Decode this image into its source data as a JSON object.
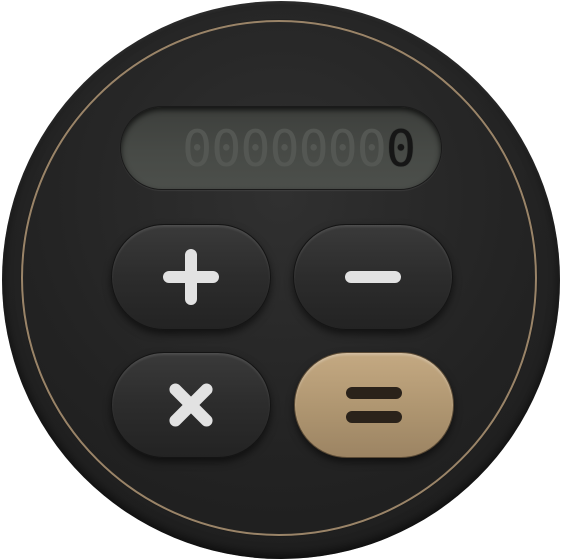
{
  "display": {
    "ghost_digits": "0000000",
    "value": "0"
  },
  "keys": {
    "add": {
      "icon": "plus-icon"
    },
    "subtract": {
      "icon": "minus-icon"
    },
    "multiply": {
      "icon": "times-icon"
    },
    "equals": {
      "icon": "equals-icon"
    }
  },
  "colors": {
    "body": "#232323",
    "ring": "#9a8468",
    "display_bg": "#474a46",
    "key_dark": "#2c2c2c",
    "key_gold": "#ae9570",
    "glyph_light": "#e2e2e2",
    "glyph_dark": "#2a221a"
  }
}
